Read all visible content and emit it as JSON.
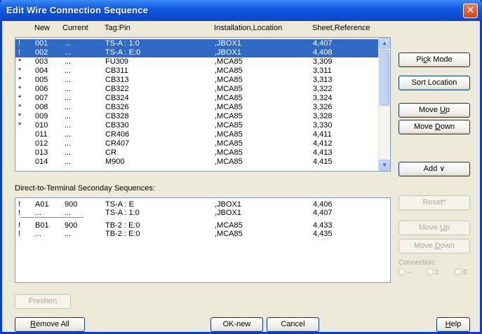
{
  "window": {
    "title": "Edit Wire Connection Sequence",
    "close_symbol": "✕"
  },
  "columns": {
    "new": "New",
    "current": "Current",
    "tagpin": "Tag:Pin",
    "location": "Installation,Location",
    "sheet": "Sheet,Reference"
  },
  "rows": [
    {
      "flag": "!",
      "new": "001",
      "current": "...",
      "tagpin": "TS-A : 1:0",
      "location": ",JBOX1",
      "sheet": "4,407",
      "selected": true
    },
    {
      "flag": "!",
      "new": "002",
      "current": "...",
      "tagpin": "TS-A : E:0",
      "location": ",JBOX1",
      "sheet": "4,408",
      "selected": true
    },
    {
      "flag": "*",
      "new": "003",
      "current": "...",
      "tagpin": "FU309",
      "location": ",MCA85",
      "sheet": "3,309",
      "selected": false
    },
    {
      "flag": "*",
      "new": "004",
      "current": "...",
      "tagpin": "CB311",
      "location": ",MCA85",
      "sheet": "3,311",
      "selected": false
    },
    {
      "flag": "*",
      "new": "005",
      "current": "...",
      "tagpin": "CB313",
      "location": ",MCA85",
      "sheet": "3,313",
      "selected": false
    },
    {
      "flag": "*",
      "new": "006",
      "current": "...",
      "tagpin": "CB322",
      "location": ",MCA85",
      "sheet": "3,322",
      "selected": false
    },
    {
      "flag": "*",
      "new": "007",
      "current": "...",
      "tagpin": "CB324",
      "location": ",MCA85",
      "sheet": "3,324",
      "selected": false
    },
    {
      "flag": "*",
      "new": "008",
      "current": "...",
      "tagpin": "CB326",
      "location": ",MCA85",
      "sheet": "3,326",
      "selected": false
    },
    {
      "flag": "*",
      "new": "009",
      "current": "...",
      "tagpin": "CB328",
      "location": ",MCA85",
      "sheet": "3,328",
      "selected": false
    },
    {
      "flag": "*",
      "new": "010",
      "current": "...",
      "tagpin": "CB330",
      "location": ",MCA85",
      "sheet": "3,330",
      "selected": false
    },
    {
      "flag": "",
      "new": "011",
      "current": "...",
      "tagpin": "CR406",
      "location": ",MCA85",
      "sheet": "4,411",
      "selected": false
    },
    {
      "flag": "",
      "new": "012",
      "current": "...",
      "tagpin": "CR407",
      "location": ",MCA85",
      "sheet": "4,412",
      "selected": false
    },
    {
      "flag": "",
      "new": "013",
      "current": "...",
      "tagpin": "CR",
      "location": ",MCA85",
      "sheet": "4,413",
      "selected": false
    },
    {
      "flag": "",
      "new": "014",
      "current": "...",
      "tagpin": "M900",
      "location": ",MCA85",
      "sheet": "4,415",
      "selected": false
    }
  ],
  "secondary_label": "Direct-to-Terminal Seconday Sequences:",
  "secondary_rows": [
    {
      "flag": "!",
      "new": "A01",
      "current": "900",
      "tagpin": "TS-A : E",
      "location": ",JBOX1",
      "sheet": "4,406"
    },
    {
      "flag": "!",
      "new": "...",
      "current": "...",
      "tagpin": "TS-A : 1:0",
      "location": ",JBOX1",
      "sheet": "4,407"
    },
    {
      "flag": "!",
      "new": "B01",
      "current": "900",
      "tagpin": "TB-2 : E:0",
      "location": ",MCA85",
      "sheet": "4,433"
    },
    {
      "flag": "!",
      "new": "...",
      "current": "...",
      "tagpin": "TB-2 : E:0",
      "location": ",MCA85",
      "sheet": "4,435"
    }
  ],
  "buttons": {
    "pick_mode": {
      "pre": "Pi",
      "u": "c",
      "post": "k Mode"
    },
    "sort_location": "Sort Location",
    "move_up": {
      "pre": "Move ",
      "u": "U",
      "post": "p"
    },
    "move_down": {
      "pre": "Move ",
      "u": "D",
      "post": "own"
    },
    "add": "Add ∨",
    "reset": "Reset*",
    "move_up2": {
      "pre": "Move ",
      "u": "U",
      "post": "p"
    },
    "move_down2": {
      "pre": "Move ",
      "u": "D",
      "post": "own"
    },
    "freshen": "Freshen",
    "remove_all": {
      "pre": "",
      "u": "R",
      "post": "emove All"
    },
    "ok_new": "OK-new",
    "cancel": "Cancel",
    "help": {
      "pre": "",
      "u": "H",
      "post": "elp"
    }
  },
  "connection": {
    "label": "Connection:",
    "options": [
      "--",
      "1",
      "E"
    ]
  }
}
